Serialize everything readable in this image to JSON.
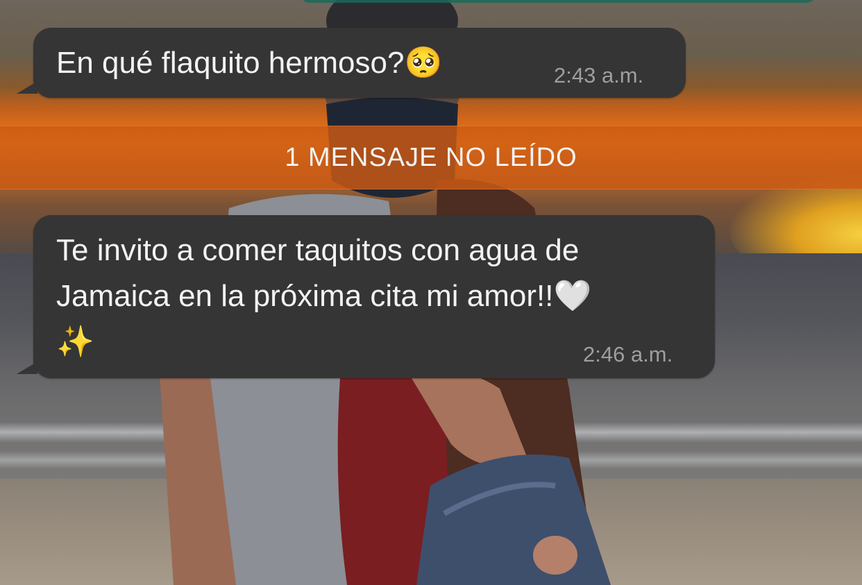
{
  "chat": {
    "messages": [
      {
        "text": "En qué flaquito hermoso?",
        "emoji": "🥺",
        "time": "2:43 a.m."
      },
      {
        "lines": [
          "Te invito a comer taquitos con agua de",
          "Jamaica en la próxima cita mi amor!!"
        ],
        "emoji_inline": "🤍",
        "emoji_line": "✨",
        "time": "2:46 a.m."
      }
    ],
    "unread_divider": "1 MENSAJE NO LEÍDO"
  },
  "colors": {
    "bubble_incoming": "#353535",
    "unread_bar": "#cd5a14",
    "timestamp": "#9e9e9e"
  }
}
